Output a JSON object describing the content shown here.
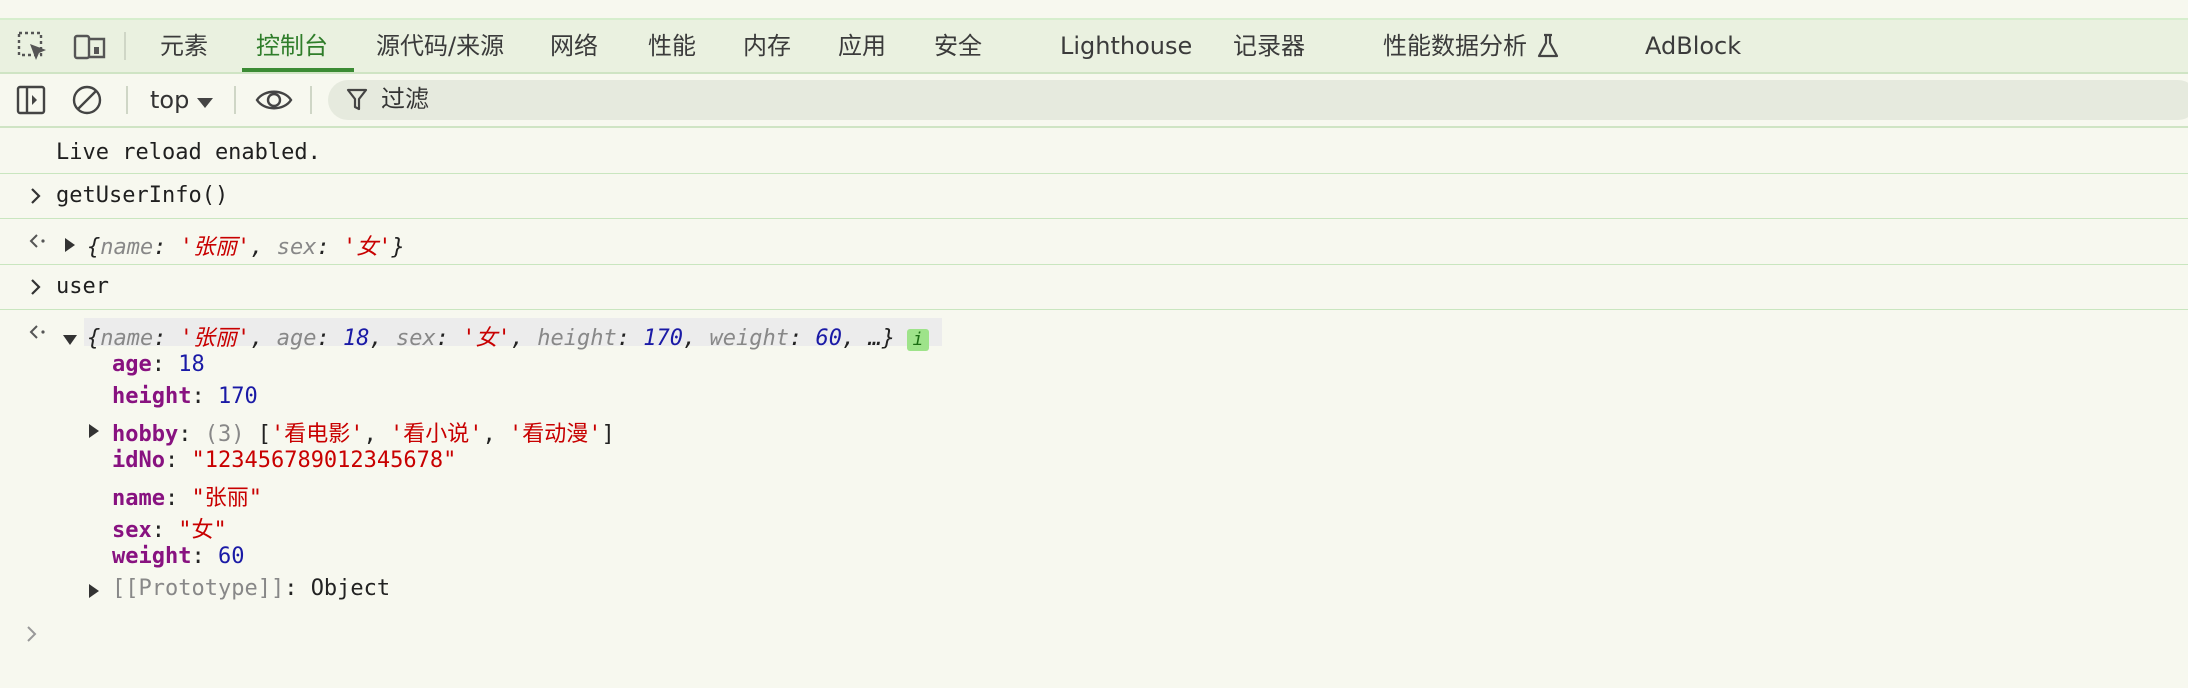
{
  "tabs": [
    {
      "label": "元素",
      "active": false
    },
    {
      "label": "控制台",
      "active": true
    },
    {
      "label": "源代码/来源",
      "active": false
    },
    {
      "label": "网络",
      "active": false
    },
    {
      "label": "性能",
      "active": false
    },
    {
      "label": "内存",
      "active": false
    },
    {
      "label": "应用",
      "active": false
    },
    {
      "label": "安全",
      "active": false
    },
    {
      "label": "Lighthouse",
      "active": false
    },
    {
      "label": "记录器",
      "active": false
    },
    {
      "label": "性能数据分析",
      "active": false
    },
    {
      "label": "AdBlock",
      "active": false
    }
  ],
  "toolbar": {
    "context": "top",
    "filter_placeholder": "过滤"
  },
  "console": {
    "live_reload": "Live reload enabled.",
    "cmd1": "getUserInfo()",
    "res1": {
      "open": "{",
      "k1": "name",
      "v1": "'张丽'",
      "k2": "sex",
      "v2": "'女'",
      "close": "}"
    },
    "cmd2": "user",
    "res2": {
      "open": "{",
      "k_name": "name",
      "v_name": "'张丽'",
      "k_age": "age",
      "v_age": "18",
      "k_sex": "sex",
      "v_sex": "'女'",
      "k_height": "height",
      "v_height": "170",
      "k_weight": "weight",
      "v_weight": "60",
      "ellipsis": "…}",
      "info": "i"
    },
    "props": {
      "age_k": "age",
      "age_v": "18",
      "height_k": "height",
      "height_v": "170",
      "hobby_k": "hobby",
      "hobby_count": "(3)",
      "hobby_items": [
        "'看电影'",
        "'看小说'",
        "'看动漫'"
      ],
      "idno_k": "idNo",
      "idno_v": "\"123456789012345678\"",
      "name_k": "name",
      "name_v": "\"张丽\"",
      "sex_k": "sex",
      "sex_v": "\"女\"",
      "weight_k": "weight",
      "weight_v": "60",
      "proto_k": "[[Prototype]]",
      "proto_v": "Object"
    }
  },
  "colors": {
    "accent": "#2f7d2a",
    "key": "#881280",
    "number": "#1a1aa6",
    "string": "#c80000"
  },
  "icons": [
    "inspect-element-icon",
    "device-toolbar-icon",
    "sidebar-toggle-icon",
    "clear-console-icon",
    "caret-down-icon",
    "eye-icon",
    "filter-icon",
    "flask-icon",
    "chevron-right-icon",
    "return-arrow-icon",
    "triangle-right-icon",
    "triangle-down-icon"
  ]
}
